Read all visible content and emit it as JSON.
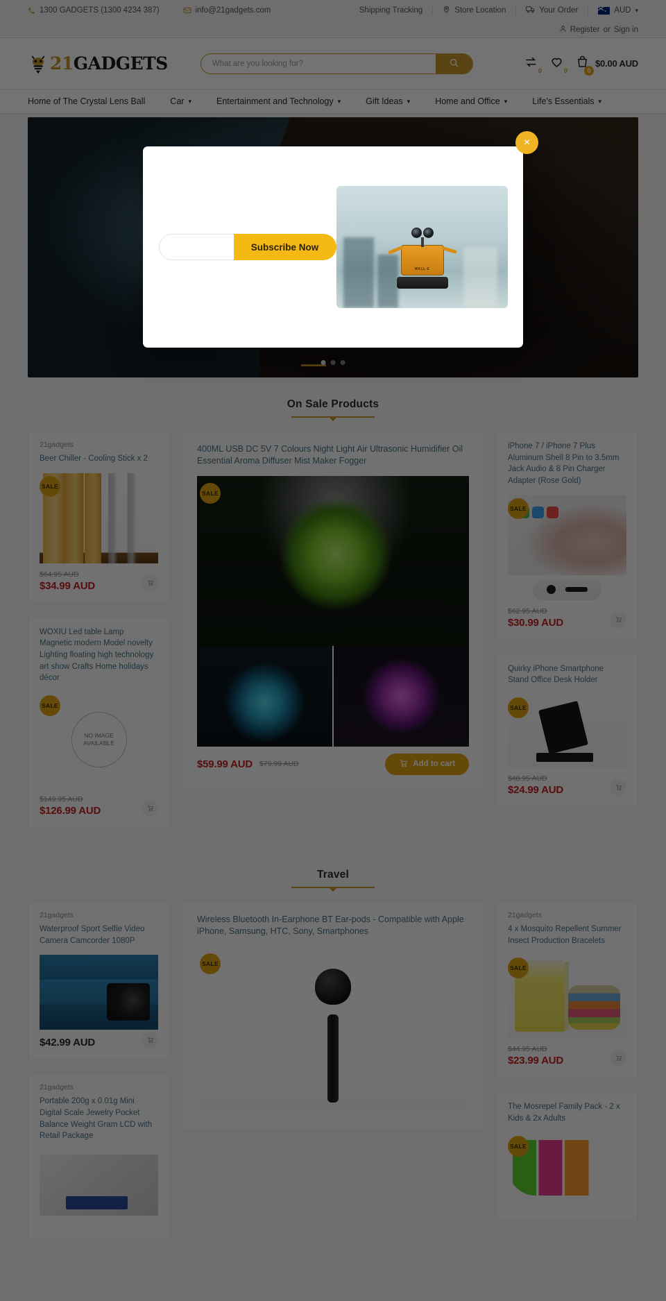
{
  "topbar": {
    "phone": "1300 GADGETS (1300 4234 387)",
    "email": "info@21gadgets.com",
    "links": [
      {
        "label": "Shipping Tracking",
        "icon": "none"
      },
      {
        "label": "Store Location",
        "icon": "map-pin-icon"
      },
      {
        "label": "Your Order",
        "icon": "truck-icon"
      }
    ],
    "currency": "AUD",
    "register": "Register",
    "or": "or",
    "signin": "Sign in"
  },
  "header": {
    "logo_21": "21",
    "logo_gadgets": "GADGETS",
    "search_placeholder": "What are you looking for?",
    "search_value": "",
    "compare_count": "0",
    "wishlist_count": "0",
    "cart_count": "0",
    "cart_total": "$0.00 AUD"
  },
  "nav": {
    "items": [
      {
        "label": "Home of The Crystal Lens Ball",
        "has_caret": false
      },
      {
        "label": "Car",
        "has_caret": true
      },
      {
        "label": "Entertainment and Technology",
        "has_caret": true
      },
      {
        "label": "Gift Ideas",
        "has_caret": true
      },
      {
        "label": "Home and Office",
        "has_caret": true
      },
      {
        "label": "Life's Essentials",
        "has_caret": true
      }
    ]
  },
  "modal": {
    "close_label": "×",
    "email_placeholder": "",
    "email_value": "",
    "subscribe_label": "Subscribe Now",
    "image_alt": "wall-e-robot"
  },
  "sections": [
    {
      "title": "On Sale Products",
      "left": [
        {
          "vendor": "21gadgets",
          "title": "Beer Chiller - Cooling Stick x 2",
          "sale": "SALE",
          "price_old": "$64.95 AUD",
          "price_new": "$34.99 AUD",
          "art": "art-beer"
        },
        {
          "vendor": "",
          "title": "WOXIU Led table Lamp Magnetic modern Model novelty Lighting floating high technology art show Crafts Home holidays décor",
          "sale": "SALE",
          "price_old": "$149.95 AUD",
          "price_new": "$126.99 AUD",
          "art": "no-image",
          "noimg_line1": "NO IMAGE",
          "noimg_line2": "AVAILABLE"
        }
      ],
      "center": {
        "vendor": "",
        "title": "400ML USB DC 5V 7 Colours Night Light Air Ultrasonic Humidifier Oil Essential Aroma Diffuser Mist Maker Fogger",
        "sale": "SALE",
        "price_new": "$59.99 AUD",
        "price_old": "$79.99 AUD",
        "add_to_cart": "Add to cart"
      },
      "right": [
        {
          "vendor": "",
          "title": "iPhone 7 / iPhone 7 Plus Aluminum Shell 8 Pin to 3.5mm Jack Audio & 8 Pin Charger Adapter (Rose Gold)",
          "sale": "SALE",
          "price_old": "$62.95 AUD",
          "price_new": "$30.99 AUD",
          "art": "art-iphone"
        },
        {
          "vendor": "",
          "title": "Quirky iPhone Smartphone Stand Office Desk Holder",
          "sale": "SALE",
          "price_old": "$48.95 AUD",
          "price_new": "$24.99 AUD",
          "art": "art-stand"
        }
      ]
    },
    {
      "title": "Travel",
      "left": [
        {
          "vendor": "21gadgets",
          "title": "Waterproof Sport Selfie Video Camera Camcorder 1080P",
          "sale": "",
          "price_old": "",
          "price_new": "$42.99 AUD",
          "art": "art-cam"
        },
        {
          "vendor": "21gadgets",
          "title": "Portable 200g x 0.01g Mini Digital Scale Jewelry Pocket Balance Weight Gram LCD with Retail Package",
          "sale": "",
          "price_old": "",
          "price_new": "",
          "art": "art-scale"
        }
      ],
      "center": {
        "vendor": "",
        "title": "Wireless Bluetooth In-Earphone BT Ear-pods - Compatible with Apple iPhone, Samsung, HTC, Sony, Smartphones",
        "sale": "SALE",
        "price_new": "",
        "price_old": "",
        "add_to_cart": ""
      },
      "right": [
        {
          "vendor": "21gadgets",
          "title": "4 x Mosquito Repellent Summer Insect Production Bracelets",
          "sale": "SALE",
          "price_old": "$44.95 AUD",
          "price_new": "$23.99 AUD",
          "art": "art-mosq"
        },
        {
          "vendor": "",
          "title": "The Mosrepel Family Pack - 2 x Kids & 2x Adults",
          "sale": "SALE",
          "price_old": "",
          "price_new": "",
          "art": "art-bands"
        }
      ]
    }
  ],
  "colors": {
    "accent": "#c8962a",
    "accent_light": "#f0b323",
    "sale_price": "#c02020",
    "link": "#4a6f85"
  }
}
